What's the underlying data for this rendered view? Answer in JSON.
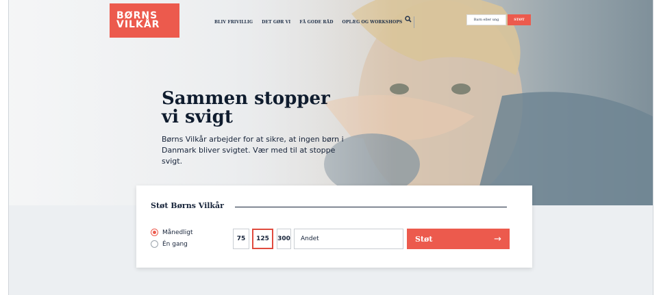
{
  "brand": {
    "line1": "BØRNS",
    "line2": "VILKÅR",
    "color": "#ec5a4d"
  },
  "nav": {
    "items": [
      "BLIV FRIVILLIG",
      "DET GØR VI",
      "FÅ GODE RÅD",
      "OPLÆG OG WORKSHOPS"
    ]
  },
  "header": {
    "search_icon": "search-icon",
    "child_button": "Barn eller ung",
    "support_button": "STØT"
  },
  "hero": {
    "headline": "Sammen stopper vi svigt",
    "intro": "Børns Vilkår arbejder for at sikre, at ingen børn i Danmark bliver svigtet. Vær med til at stoppe svigt."
  },
  "donation": {
    "title": "Støt Børns Vilkår",
    "frequency": [
      {
        "label": "Månedligt",
        "selected": true
      },
      {
        "label": "Én gang",
        "selected": false
      }
    ],
    "amounts": [
      {
        "label": "75",
        "selected": false
      },
      {
        "label": "125",
        "selected": true
      },
      {
        "label": "300",
        "selected": false
      }
    ],
    "other_label": "Andet",
    "submit_label": "Støt",
    "submit_arrow": "→"
  }
}
